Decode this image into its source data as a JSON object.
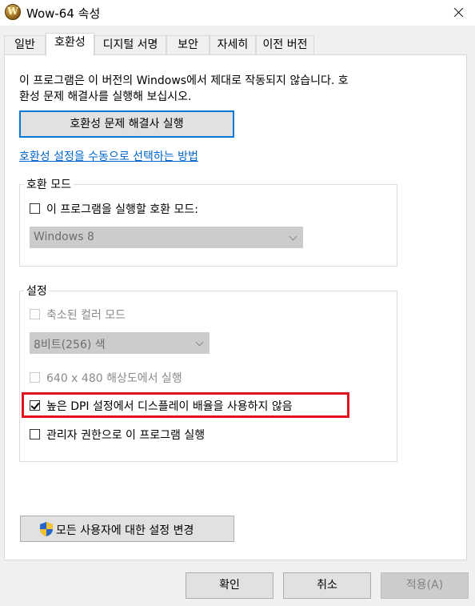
{
  "window": {
    "title": "Wow-64 속성",
    "icon_letter": "W"
  },
  "tabs": [
    {
      "label": "일반"
    },
    {
      "label": "호환성",
      "active": true
    },
    {
      "label": "디지털 서명"
    },
    {
      "label": "보안"
    },
    {
      "label": "자세히"
    },
    {
      "label": "이전 버전"
    }
  ],
  "compat": {
    "description_line1": "이 프로그램은 이 버전의 Windows에서 제대로 작동되지 않습니다. 호",
    "description_line2": "환성 문제 해결사를 실행해 보십시오.",
    "troubleshooter_button": "호환성 문제 해결사 실행",
    "manual_link": "호환성 설정을 수동으로 선택하는 방법"
  },
  "compat_mode": {
    "legend": "호환 모드",
    "checkbox_label": "이 프로그램을 실행할 호환 모드:",
    "checked": false,
    "select_value": "Windows 8"
  },
  "settings": {
    "legend": "설정",
    "reduced_color_label": "축소된 컬러 모드",
    "color_select_value": "8비트(256) 색",
    "resolution_label": "640 x 480 해상도에서 실행",
    "dpi_label": "높은 DPI 설정에서 디스플레이 배율을 사용하지 않음",
    "dpi_checked": true,
    "admin_label": "관리자 권한으로 이 프로그램 실행",
    "admin_checked": false
  },
  "all_users_button": "모든 사용자에 대한 설정 변경",
  "footer": {
    "ok": "확인",
    "cancel": "취소",
    "apply": "적용(A)"
  },
  "colors": {
    "highlight": "#e0121b",
    "link": "#0066cc",
    "focus": "#0078d7"
  }
}
